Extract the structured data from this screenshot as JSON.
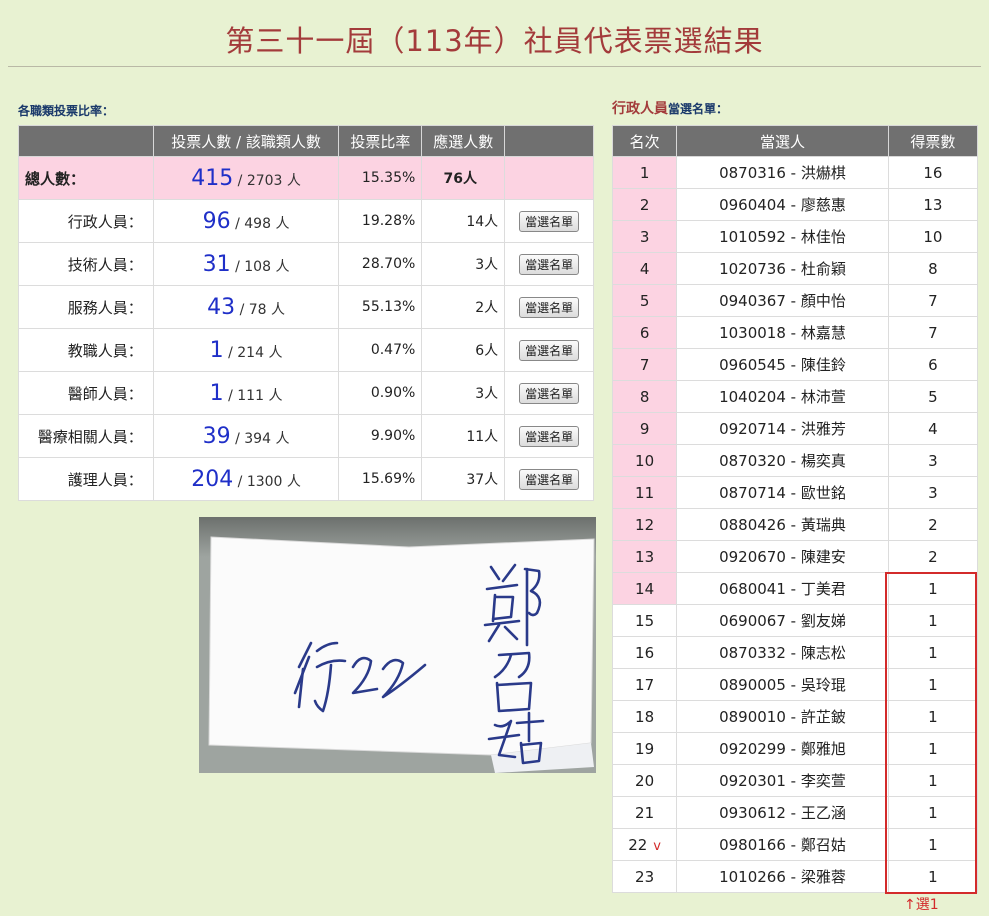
{
  "page_title": "第三十一屆（113年）社員代表票選結果",
  "stats_caption": "各職類投票比率：",
  "winners_caption": {
    "category": "行政人員",
    "suffix": "當選名單："
  },
  "stats_table": {
    "headers": [
      "",
      "投票人數 / 該職類人數",
      "投票比率",
      "應選人數",
      ""
    ],
    "total": {
      "label": "總人數：",
      "voted": "415",
      "total": "/ 2703 人",
      "rate": "15.35%",
      "seats": "76人"
    },
    "rows": [
      {
        "label": "行政人員：",
        "voted": "96",
        "total": "/ 498 人",
        "rate": "19.28%",
        "seats": "14人",
        "button": "當選名單"
      },
      {
        "label": "技術人員：",
        "voted": "31",
        "total": "/ 108 人",
        "rate": "28.70%",
        "seats": "3人",
        "button": "當選名單"
      },
      {
        "label": "服務人員：",
        "voted": "43",
        "total": "/ 78 人",
        "rate": "55.13%",
        "seats": "2人",
        "button": "當選名單"
      },
      {
        "label": "教職人員：",
        "voted": "1",
        "total": "/ 214 人",
        "rate": "0.47%",
        "seats": "6人",
        "button": "當選名單"
      },
      {
        "label": "醫師人員：",
        "voted": "1",
        "total": "/ 111 人",
        "rate": "0.90%",
        "seats": "3人",
        "button": "當選名單"
      },
      {
        "label": "醫療相關人員：",
        "voted": "39",
        "total": "/ 394 人",
        "rate": "9.90%",
        "seats": "11人",
        "button": "當選名單"
      },
      {
        "label": "護理人員：",
        "voted": "204",
        "total": "/ 1300 人",
        "rate": "15.69%",
        "seats": "37人",
        "button": "當選名單"
      }
    ]
  },
  "winners_table": {
    "headers": [
      "名次",
      "當選人",
      "得票數"
    ],
    "rows": [
      {
        "rank": "1",
        "name": "0870316 - 洪爀棋",
        "votes": "16",
        "elected": true,
        "mark": ""
      },
      {
        "rank": "2",
        "name": "0960404 - 廖慈惠",
        "votes": "13",
        "elected": true,
        "mark": ""
      },
      {
        "rank": "3",
        "name": "1010592 - 林佳怡",
        "votes": "10",
        "elected": true,
        "mark": ""
      },
      {
        "rank": "4",
        "name": "1020736 - 杜俞穎",
        "votes": "8",
        "elected": true,
        "mark": ""
      },
      {
        "rank": "5",
        "name": "0940367 - 顏中怡",
        "votes": "7",
        "elected": true,
        "mark": ""
      },
      {
        "rank": "6",
        "name": "1030018 - 林嘉慧",
        "votes": "7",
        "elected": true,
        "mark": ""
      },
      {
        "rank": "7",
        "name": "0960545 - 陳佳鈴",
        "votes": "6",
        "elected": true,
        "mark": ""
      },
      {
        "rank": "8",
        "name": "1040204 - 林沛萱",
        "votes": "5",
        "elected": true,
        "mark": ""
      },
      {
        "rank": "9",
        "name": "0920714 - 洪雅芳",
        "votes": "4",
        "elected": true,
        "mark": ""
      },
      {
        "rank": "10",
        "name": "0870320 - 楊奕真",
        "votes": "3",
        "elected": true,
        "mark": ""
      },
      {
        "rank": "11",
        "name": "0870714 - 歐世銘",
        "votes": "3",
        "elected": true,
        "mark": ""
      },
      {
        "rank": "12",
        "name": "0880426 - 黃瑞典",
        "votes": "2",
        "elected": true,
        "mark": ""
      },
      {
        "rank": "13",
        "name": "0920670 - 陳建安",
        "votes": "2",
        "elected": true,
        "mark": ""
      },
      {
        "rank": "14",
        "name": "0680041 - 丁美君",
        "votes": "1",
        "elected": true,
        "mark": ""
      },
      {
        "rank": "15",
        "name": "0690067 - 劉友娣",
        "votes": "1",
        "elected": false,
        "mark": ""
      },
      {
        "rank": "16",
        "name": "0870332 - 陳志松",
        "votes": "1",
        "elected": false,
        "mark": ""
      },
      {
        "rank": "17",
        "name": "0890005 - 吳玲琨",
        "votes": "1",
        "elected": false,
        "mark": ""
      },
      {
        "rank": "18",
        "name": "0890010 - 許芷鈹",
        "votes": "1",
        "elected": false,
        "mark": ""
      },
      {
        "rank": "19",
        "name": "0920299 - 鄭雅旭",
        "votes": "1",
        "elected": false,
        "mark": ""
      },
      {
        "rank": "20",
        "name": "0920301 - 李奕萱",
        "votes": "1",
        "elected": false,
        "mark": ""
      },
      {
        "rank": "21",
        "name": "0930612 - 王乙涵",
        "votes": "1",
        "elected": false,
        "mark": ""
      },
      {
        "rank": "22",
        "name": "0980166 - 鄭召姑",
        "votes": "1",
        "elected": false,
        "mark": "v"
      },
      {
        "rank": "23",
        "name": "1010266 - 梁雅蓉",
        "votes": "1",
        "elected": false,
        "mark": ""
      }
    ]
  },
  "annotation_note": "↑選1",
  "ballot_photo": {
    "handwriting": [
      "行22",
      "鄭召姑"
    ]
  },
  "colors": {
    "background": "#e8f2d2",
    "title": "#a33b3b",
    "header": "#707070",
    "highlight_pink": "#fcd3e2",
    "vote_count_blue": "#1f2fc8",
    "annotation_red": "#d32b2b"
  }
}
